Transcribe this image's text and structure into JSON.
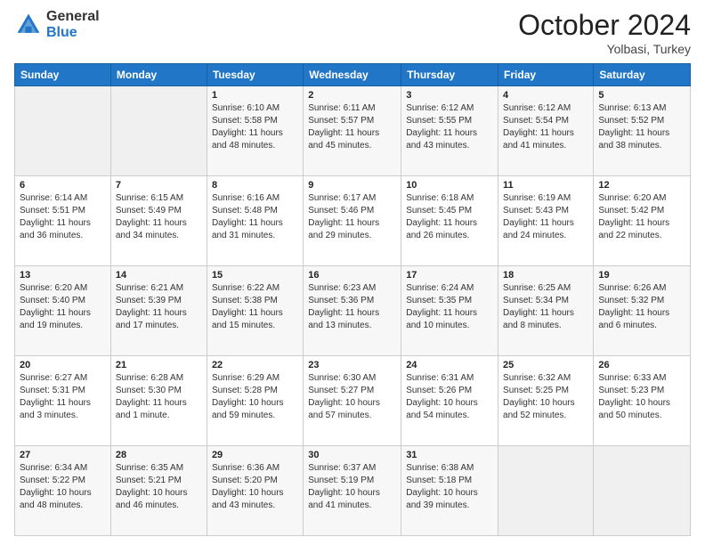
{
  "header": {
    "logo_general": "General",
    "logo_blue": "Blue",
    "month": "October 2024",
    "location": "Yolbasi, Turkey"
  },
  "days_of_week": [
    "Sunday",
    "Monday",
    "Tuesday",
    "Wednesday",
    "Thursday",
    "Friday",
    "Saturday"
  ],
  "weeks": [
    [
      {
        "day": "",
        "sunrise": "",
        "sunset": "",
        "daylight": ""
      },
      {
        "day": "",
        "sunrise": "",
        "sunset": "",
        "daylight": ""
      },
      {
        "day": "1",
        "sunrise": "Sunrise: 6:10 AM",
        "sunset": "Sunset: 5:58 PM",
        "daylight": "Daylight: 11 hours and 48 minutes."
      },
      {
        "day": "2",
        "sunrise": "Sunrise: 6:11 AM",
        "sunset": "Sunset: 5:57 PM",
        "daylight": "Daylight: 11 hours and 45 minutes."
      },
      {
        "day": "3",
        "sunrise": "Sunrise: 6:12 AM",
        "sunset": "Sunset: 5:55 PM",
        "daylight": "Daylight: 11 hours and 43 minutes."
      },
      {
        "day": "4",
        "sunrise": "Sunrise: 6:12 AM",
        "sunset": "Sunset: 5:54 PM",
        "daylight": "Daylight: 11 hours and 41 minutes."
      },
      {
        "day": "5",
        "sunrise": "Sunrise: 6:13 AM",
        "sunset": "Sunset: 5:52 PM",
        "daylight": "Daylight: 11 hours and 38 minutes."
      }
    ],
    [
      {
        "day": "6",
        "sunrise": "Sunrise: 6:14 AM",
        "sunset": "Sunset: 5:51 PM",
        "daylight": "Daylight: 11 hours and 36 minutes."
      },
      {
        "day": "7",
        "sunrise": "Sunrise: 6:15 AM",
        "sunset": "Sunset: 5:49 PM",
        "daylight": "Daylight: 11 hours and 34 minutes."
      },
      {
        "day": "8",
        "sunrise": "Sunrise: 6:16 AM",
        "sunset": "Sunset: 5:48 PM",
        "daylight": "Daylight: 11 hours and 31 minutes."
      },
      {
        "day": "9",
        "sunrise": "Sunrise: 6:17 AM",
        "sunset": "Sunset: 5:46 PM",
        "daylight": "Daylight: 11 hours and 29 minutes."
      },
      {
        "day": "10",
        "sunrise": "Sunrise: 6:18 AM",
        "sunset": "Sunset: 5:45 PM",
        "daylight": "Daylight: 11 hours and 26 minutes."
      },
      {
        "day": "11",
        "sunrise": "Sunrise: 6:19 AM",
        "sunset": "Sunset: 5:43 PM",
        "daylight": "Daylight: 11 hours and 24 minutes."
      },
      {
        "day": "12",
        "sunrise": "Sunrise: 6:20 AM",
        "sunset": "Sunset: 5:42 PM",
        "daylight": "Daylight: 11 hours and 22 minutes."
      }
    ],
    [
      {
        "day": "13",
        "sunrise": "Sunrise: 6:20 AM",
        "sunset": "Sunset: 5:40 PM",
        "daylight": "Daylight: 11 hours and 19 minutes."
      },
      {
        "day": "14",
        "sunrise": "Sunrise: 6:21 AM",
        "sunset": "Sunset: 5:39 PM",
        "daylight": "Daylight: 11 hours and 17 minutes."
      },
      {
        "day": "15",
        "sunrise": "Sunrise: 6:22 AM",
        "sunset": "Sunset: 5:38 PM",
        "daylight": "Daylight: 11 hours and 15 minutes."
      },
      {
        "day": "16",
        "sunrise": "Sunrise: 6:23 AM",
        "sunset": "Sunset: 5:36 PM",
        "daylight": "Daylight: 11 hours and 13 minutes."
      },
      {
        "day": "17",
        "sunrise": "Sunrise: 6:24 AM",
        "sunset": "Sunset: 5:35 PM",
        "daylight": "Daylight: 11 hours and 10 minutes."
      },
      {
        "day": "18",
        "sunrise": "Sunrise: 6:25 AM",
        "sunset": "Sunset: 5:34 PM",
        "daylight": "Daylight: 11 hours and 8 minutes."
      },
      {
        "day": "19",
        "sunrise": "Sunrise: 6:26 AM",
        "sunset": "Sunset: 5:32 PM",
        "daylight": "Daylight: 11 hours and 6 minutes."
      }
    ],
    [
      {
        "day": "20",
        "sunrise": "Sunrise: 6:27 AM",
        "sunset": "Sunset: 5:31 PM",
        "daylight": "Daylight: 11 hours and 3 minutes."
      },
      {
        "day": "21",
        "sunrise": "Sunrise: 6:28 AM",
        "sunset": "Sunset: 5:30 PM",
        "daylight": "Daylight: 11 hours and 1 minute."
      },
      {
        "day": "22",
        "sunrise": "Sunrise: 6:29 AM",
        "sunset": "Sunset: 5:28 PM",
        "daylight": "Daylight: 10 hours and 59 minutes."
      },
      {
        "day": "23",
        "sunrise": "Sunrise: 6:30 AM",
        "sunset": "Sunset: 5:27 PM",
        "daylight": "Daylight: 10 hours and 57 minutes."
      },
      {
        "day": "24",
        "sunrise": "Sunrise: 6:31 AM",
        "sunset": "Sunset: 5:26 PM",
        "daylight": "Daylight: 10 hours and 54 minutes."
      },
      {
        "day": "25",
        "sunrise": "Sunrise: 6:32 AM",
        "sunset": "Sunset: 5:25 PM",
        "daylight": "Daylight: 10 hours and 52 minutes."
      },
      {
        "day": "26",
        "sunrise": "Sunrise: 6:33 AM",
        "sunset": "Sunset: 5:23 PM",
        "daylight": "Daylight: 10 hours and 50 minutes."
      }
    ],
    [
      {
        "day": "27",
        "sunrise": "Sunrise: 6:34 AM",
        "sunset": "Sunset: 5:22 PM",
        "daylight": "Daylight: 10 hours and 48 minutes."
      },
      {
        "day": "28",
        "sunrise": "Sunrise: 6:35 AM",
        "sunset": "Sunset: 5:21 PM",
        "daylight": "Daylight: 10 hours and 46 minutes."
      },
      {
        "day": "29",
        "sunrise": "Sunrise: 6:36 AM",
        "sunset": "Sunset: 5:20 PM",
        "daylight": "Daylight: 10 hours and 43 minutes."
      },
      {
        "day": "30",
        "sunrise": "Sunrise: 6:37 AM",
        "sunset": "Sunset: 5:19 PM",
        "daylight": "Daylight: 10 hours and 41 minutes."
      },
      {
        "day": "31",
        "sunrise": "Sunrise: 6:38 AM",
        "sunset": "Sunset: 5:18 PM",
        "daylight": "Daylight: 10 hours and 39 minutes."
      },
      {
        "day": "",
        "sunrise": "",
        "sunset": "",
        "daylight": ""
      },
      {
        "day": "",
        "sunrise": "",
        "sunset": "",
        "daylight": ""
      }
    ]
  ]
}
